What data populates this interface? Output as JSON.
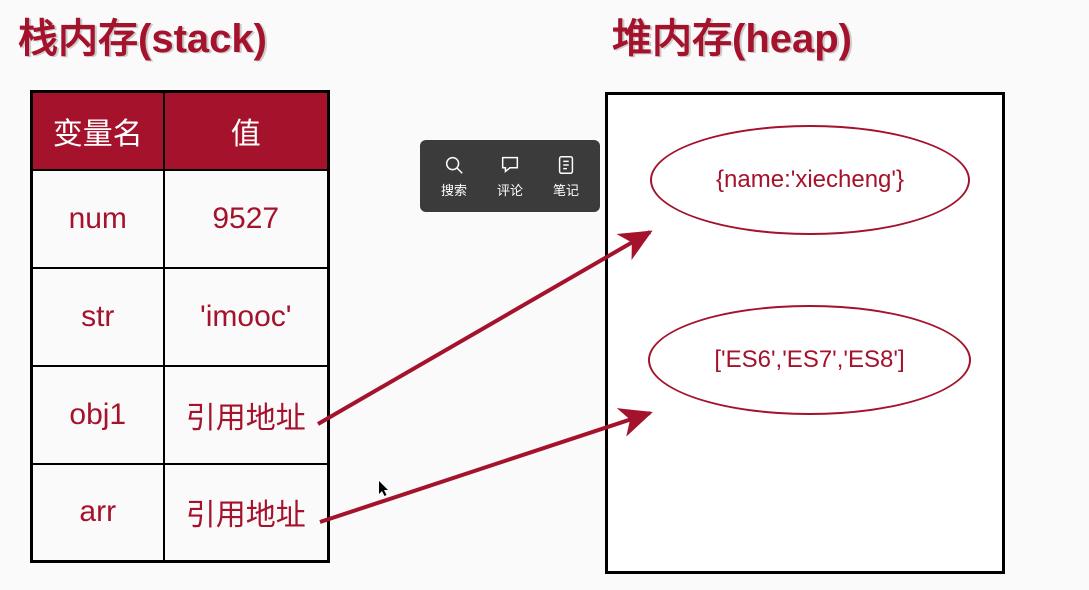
{
  "titles": {
    "stack": "栈内存(stack)",
    "heap": "堆内存(heap)"
  },
  "stack_table": {
    "headers": {
      "name": "变量名",
      "value": "值"
    },
    "rows": [
      {
        "name": "num",
        "value": "9527"
      },
      {
        "name": "str",
        "value": "'imooc'"
      },
      {
        "name": "obj1",
        "value": "引用地址"
      },
      {
        "name": "arr",
        "value": "引用地址"
      }
    ]
  },
  "heap_objects": {
    "obj1": "{name:'xiecheng'}",
    "arr": "['ES6','ES7','ES8']"
  },
  "toolbar": {
    "search": "搜索",
    "comment": "评论",
    "note": "笔记"
  },
  "colors": {
    "brand": "#a4122c",
    "toolbar_bg": "#3b3b3b"
  }
}
